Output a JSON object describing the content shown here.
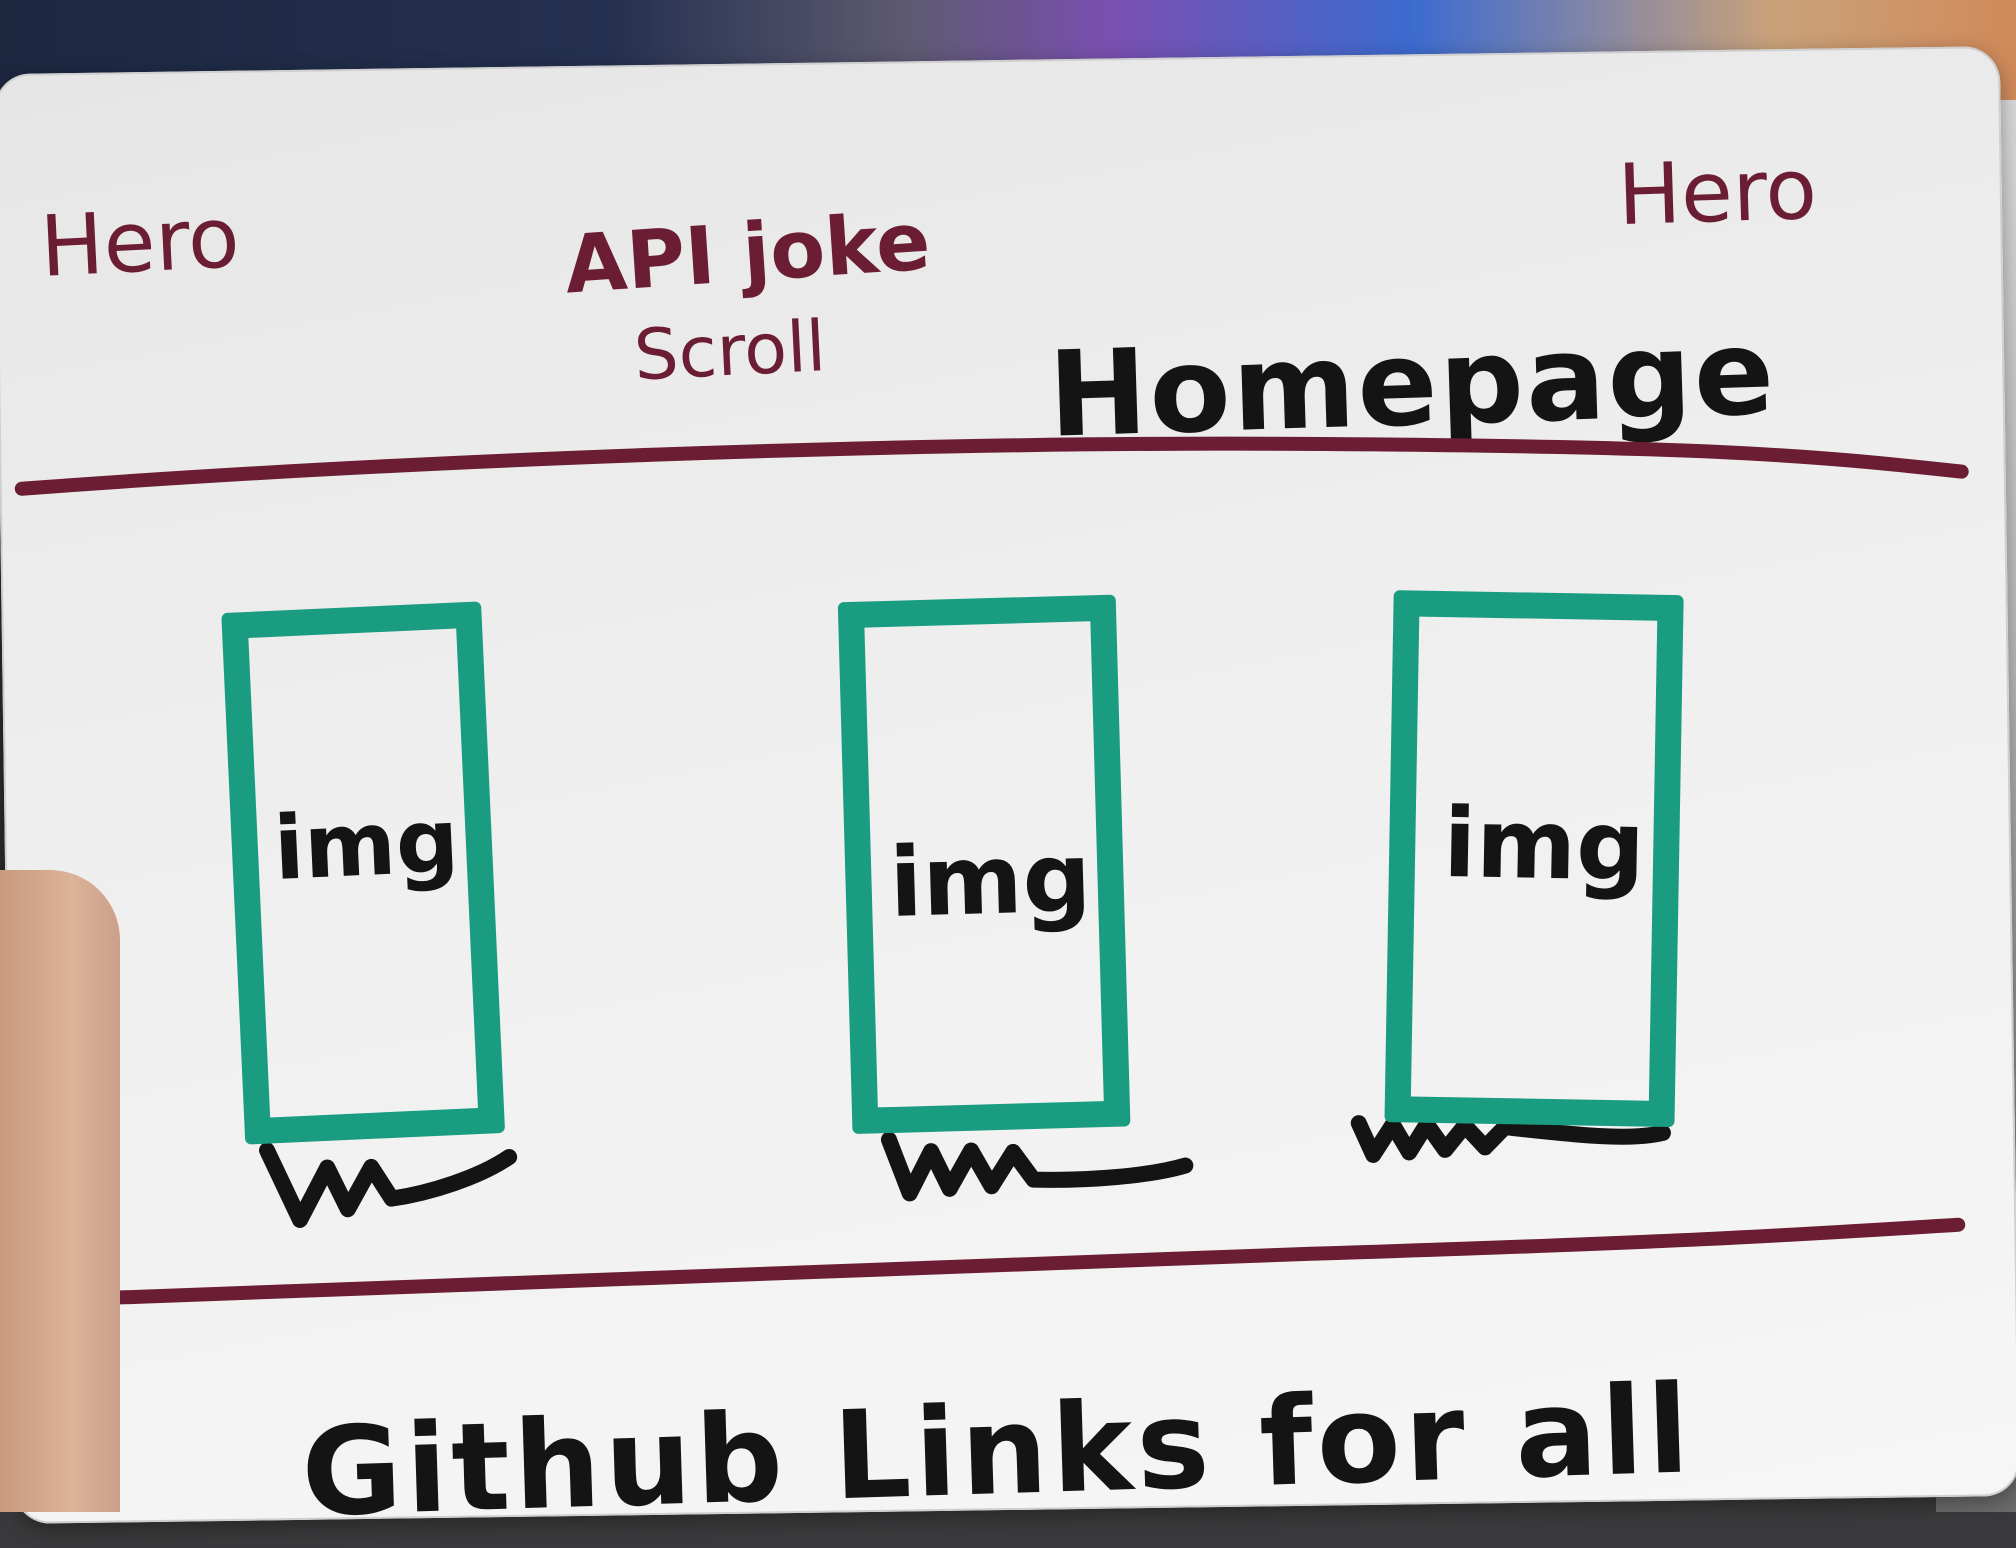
{
  "scene": {
    "description_free": true
  },
  "whiteboard": {
    "hero_left": "Hero",
    "hero_right": "Hero",
    "api_line1": "API joke",
    "api_line2": "Scroll",
    "homepage": "Homepage",
    "cards": [
      {
        "label": "img"
      },
      {
        "label": "img"
      },
      {
        "label": "img"
      }
    ],
    "footer": "Github Links for all"
  },
  "colors": {
    "maroon_marker": "#6b1d33",
    "green_marker": "#1a9c80",
    "black_marker": "#141414",
    "board": "#efefef"
  }
}
